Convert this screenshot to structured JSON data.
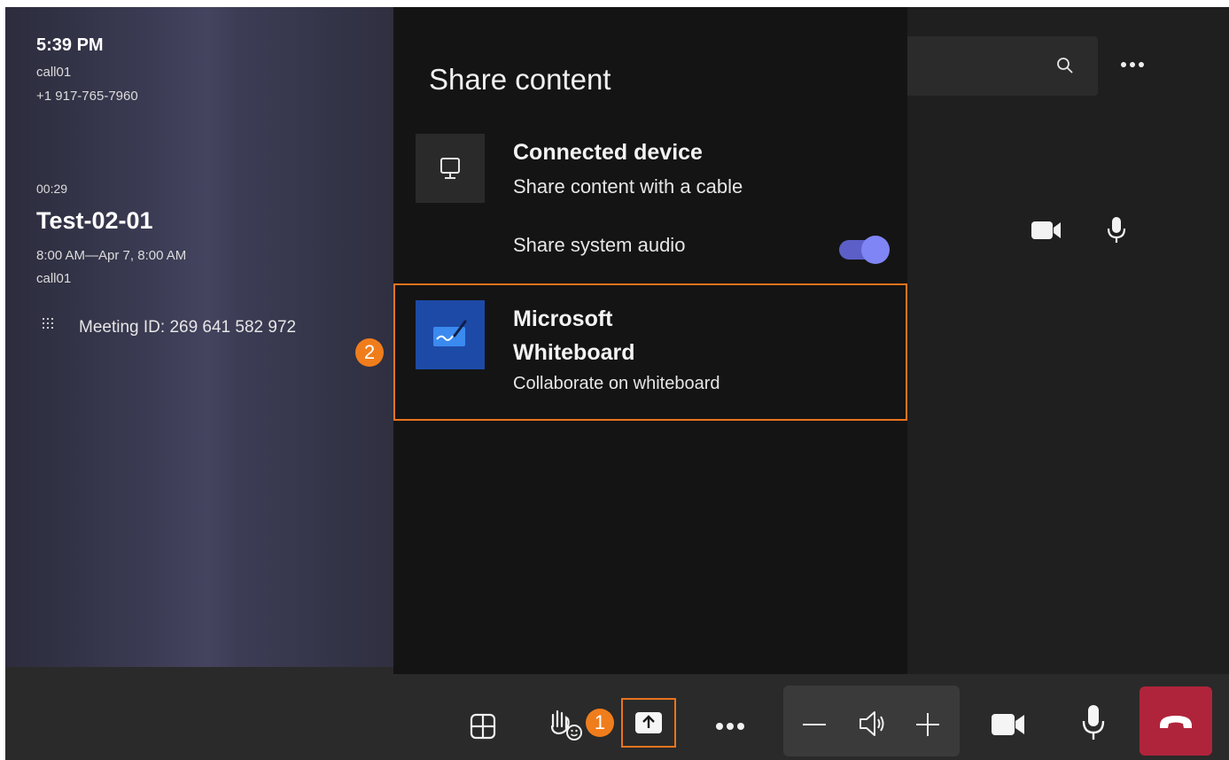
{
  "left": {
    "time": "5:39 PM",
    "caller_name": "call01",
    "caller_number": "+1 917-765-7960",
    "elapsed": "00:29",
    "meeting_title": "Test-02-01",
    "meeting_time": "8:00 AM—Apr 7, 8:00 AM",
    "organizer": "call01",
    "meeting_id_label": "Meeting ID: ",
    "meeting_id": "269 641 582 972"
  },
  "share_panel": {
    "title": "Share content",
    "connected_device": {
      "title": "Connected device",
      "subtitle": "Share content with a cable"
    },
    "system_audio": {
      "label": "Share system audio",
      "enabled": true
    },
    "whiteboard": {
      "title_line1": "Microsoft",
      "title_line2": "Whiteboard",
      "subtitle": "Collaborate on whiteboard"
    }
  },
  "callouts": {
    "one": "1",
    "two": "2"
  },
  "colors": {
    "accent_toggle": "#7f85f5",
    "highlight": "#e8741f",
    "end_call": "#b0243b",
    "whiteboard_tile": "#1d4aa7"
  },
  "icons": {
    "search": "search-icon",
    "more": "more-icon",
    "layout": "layout-grid-icon",
    "reactions": "raise-hand-icon",
    "share": "share-tray-icon",
    "volume": "speaker-icon",
    "camera": "camera-icon",
    "mic": "microphone-icon",
    "hangup": "hang-up-icon"
  }
}
